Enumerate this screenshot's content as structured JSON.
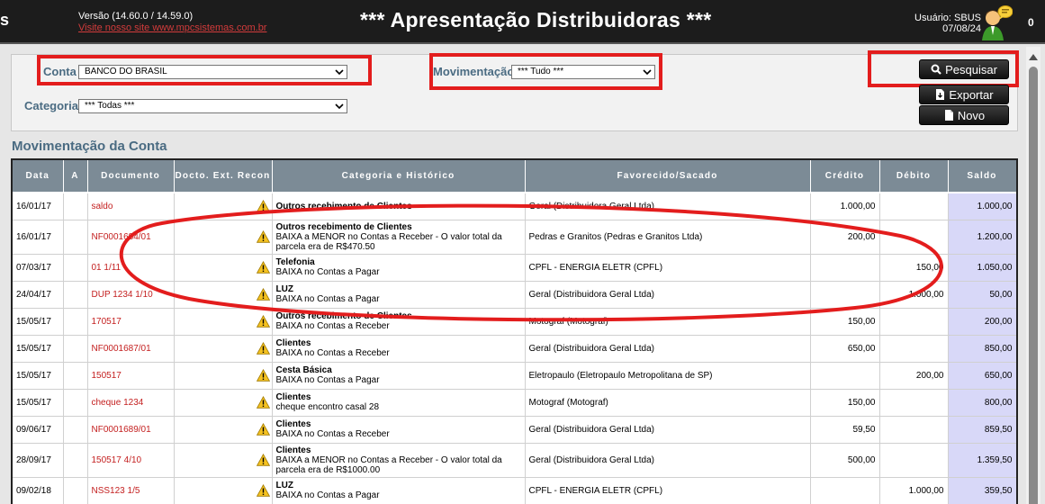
{
  "header": {
    "letter": "s",
    "version": "Versão (14.60.0 / 14.59.0)",
    "site_link": "Visite nosso site www.mpcsistemas.com.br",
    "title": "*** Apresentação Distribuidoras ***",
    "user": "Usuário: SBUS",
    "date": "07/08/24",
    "count": "0"
  },
  "filters": {
    "conta_label": "Conta",
    "conta_value": "BANCO DO BRASIL",
    "movimentacao_label": "Movimentação",
    "movimentacao_value": "*** Tudo ***",
    "categoria_label": "Categoria",
    "categoria_value": "*** Todas ***"
  },
  "buttons": {
    "pesquisar": "Pesquisar",
    "exportar": "Exportar",
    "novo": "Novo"
  },
  "section_title": "Movimentação da Conta",
  "table": {
    "headers": [
      "Data",
      "A",
      "Documento",
      "Docto. Ext. Recon",
      "Categoria e Histórico",
      "Favorecido/Sacado",
      "Crédito",
      "Débito",
      "Saldo"
    ],
    "rows": [
      {
        "data": "16/01/17",
        "documento": "saldo",
        "categoria": "Outros recebimento de Clientes",
        "historico": "",
        "favorecido": "Geral (Distribuidora Geral Ltda)",
        "credito": "1.000,00",
        "debito": "",
        "saldo": "1.000,00"
      },
      {
        "data": "16/01/17",
        "documento": "NF0001684/01",
        "categoria": "Outros recebimento de Clientes",
        "historico": "BAIXA a MENOR no Contas a Receber - O valor total da parcela era de R$470.50",
        "favorecido": "Pedras e Granitos (Pedras e Granitos Ltda)",
        "credito": "200,00",
        "debito": "",
        "saldo": "1.200,00"
      },
      {
        "data": "07/03/17",
        "documento": "01 1/11",
        "categoria": "Telefonia",
        "historico": "BAIXA no Contas a Pagar",
        "favorecido": "CPFL - ENERGIA ELETR (CPFL)",
        "credito": "",
        "debito": "150,00",
        "saldo": "1.050,00"
      },
      {
        "data": "24/04/17",
        "documento": "DUP 1234 1/10",
        "categoria": "LUZ",
        "historico": "BAIXA no Contas a Pagar",
        "favorecido": "Geral (Distribuidora Geral Ltda)",
        "credito": "",
        "debito": "1.000,00",
        "saldo": "50,00"
      },
      {
        "data": "15/05/17",
        "documento": "170517",
        "categoria": "Outros recebimento de Clientes",
        "historico": "BAIXA no Contas a Receber",
        "favorecido": "Motograf (Motograf)",
        "credito": "150,00",
        "debito": "",
        "saldo": "200,00"
      },
      {
        "data": "15/05/17",
        "documento": "NF0001687/01",
        "categoria": "Clientes",
        "historico": "BAIXA no Contas a Receber",
        "favorecido": "Geral (Distribuidora Geral Ltda)",
        "credito": "650,00",
        "debito": "",
        "saldo": "850,00"
      },
      {
        "data": "15/05/17",
        "documento": "150517",
        "categoria": "Cesta Básica",
        "historico": "BAIXA no Contas a Pagar",
        "favorecido": "Eletropaulo (Eletropaulo Metropolitana de SP)",
        "credito": "",
        "debito": "200,00",
        "saldo": "650,00"
      },
      {
        "data": "15/05/17",
        "documento": "cheque 1234",
        "categoria": "Clientes",
        "historico": "cheque encontro casal 28",
        "favorecido": "Motograf (Motograf)",
        "credito": "150,00",
        "debito": "",
        "saldo": "800,00"
      },
      {
        "data": "09/06/17",
        "documento": "NF0001689/01",
        "categoria": "Clientes",
        "historico": "BAIXA no Contas a Receber",
        "favorecido": "Geral (Distribuidora Geral Ltda)",
        "credito": "59,50",
        "debito": "",
        "saldo": "859,50"
      },
      {
        "data": "28/09/17",
        "documento": "150517 4/10",
        "categoria": "Clientes",
        "historico": "BAIXA a MENOR no Contas a Receber - O valor total da parcela era de R$1000.00",
        "favorecido": "Geral (Distribuidora Geral Ltda)",
        "credito": "500,00",
        "debito": "",
        "saldo": "1.359,50"
      },
      {
        "data": "09/02/18",
        "documento": "NSS123 1/5",
        "categoria": "LUZ",
        "historico": "BAIXA no Contas a Pagar",
        "favorecido": "CPFL - ENERGIA ELETR (CPFL)",
        "credito": "",
        "debito": "1.000,00",
        "saldo": "359,50"
      }
    ]
  },
  "colors": {
    "highlight_red": "#e31d1d",
    "label_blue": "#4a6b82",
    "header_gray": "#7c8b96",
    "saldo_bg": "#d8d8f8",
    "doc_red": "#c42020"
  }
}
